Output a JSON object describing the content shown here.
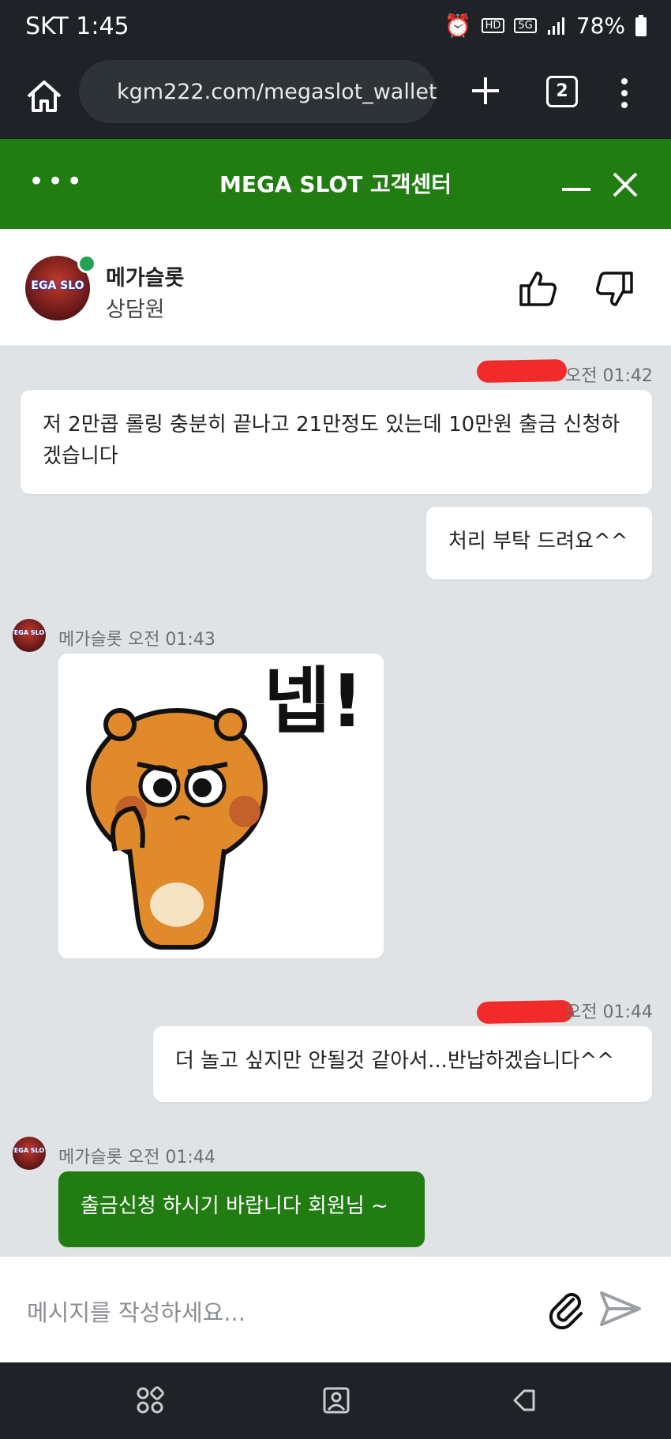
{
  "status_bar": {
    "time": "SKT 1:45",
    "hd_voice": "HD",
    "network": "5G",
    "battery": "78%"
  },
  "browser": {
    "url": "kgm222.com/megaslot_wallet",
    "tab_count": "2"
  },
  "chat_header": {
    "title": "MEGA SLOT 고객센터"
  },
  "agent": {
    "name": "메가슬롯",
    "role": "상담원",
    "avatar_text": "EGA SLO",
    "online_color": "#23a155"
  },
  "messages": [
    {
      "sender": "user",
      "time": "오전 01:42",
      "text": "저 2만콥 롤링 충분히 끝나고 21만정도 있는데 10만원 출금 신청하겠습니다"
    },
    {
      "sender": "user",
      "text": "처리 부탁 드려요^^"
    },
    {
      "sender": "agent",
      "meta": "메가슬롯 오전 01:43",
      "sticker": "bear-sticker",
      "sticker_text": "넵!"
    },
    {
      "sender": "user",
      "time": "오전 01:44",
      "text": "더 놀고 싶지만 안될것 같아서...반납하겠습니다^^"
    },
    {
      "sender": "agent",
      "meta": "메가슬롯 오전 01:44",
      "text": "출금신청 하시기 바랍니다 회원님 ~"
    }
  ],
  "composer": {
    "placeholder": "메시지를 작성하세요..."
  },
  "colors": {
    "brand_green": "#217d12",
    "chat_bg": "#dfe3e6",
    "redaction": "#f12b2b"
  }
}
